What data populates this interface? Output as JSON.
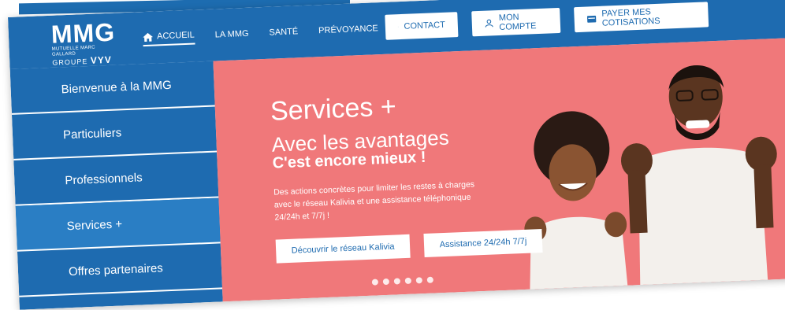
{
  "header": {
    "logo": {
      "main": "MMG",
      "tagline": "MUTUELLE MARC GALLARD",
      "group_label": "GROUPE",
      "group_name": "VYV"
    },
    "nav": [
      {
        "label": "ACCUEIL",
        "icon": "home-icon",
        "active": true
      },
      {
        "label": "LA MMG"
      },
      {
        "label": "SANTÉ"
      },
      {
        "label": "PRÉVOYANCE"
      }
    ],
    "buttons": {
      "contact": {
        "label": "CONTACT",
        "icon": "mail-icon"
      },
      "account": {
        "label": "MON COMPTE",
        "icon": "user-icon"
      },
      "pay": {
        "label": "PAYER MES COTISATIONS",
        "icon": "card-icon"
      }
    }
  },
  "sidebar": {
    "items": [
      {
        "label": "Bienvenue à la MMG"
      },
      {
        "label": "Particuliers"
      },
      {
        "label": "Professionnels"
      },
      {
        "label": "Services +"
      },
      {
        "label": "Offres partenaires"
      }
    ]
  },
  "hero": {
    "title": "Services +",
    "subtitle": "Avec les avantages",
    "strong": "C'est encore mieux !",
    "description": "Des actions concrètes pour limiter les restes à charges avec le réseau Kalivia et une assistance téléphonique 24/24h et 7/7j !",
    "button_primary": "Découvrir le réseau Kalivia",
    "button_secondary": "Assistance 24/24h 7/7j",
    "carousel_dots": 6
  },
  "colors": {
    "brand_blue": "#1e6bb0",
    "hero_pink": "#f0787a",
    "white": "#ffffff"
  }
}
